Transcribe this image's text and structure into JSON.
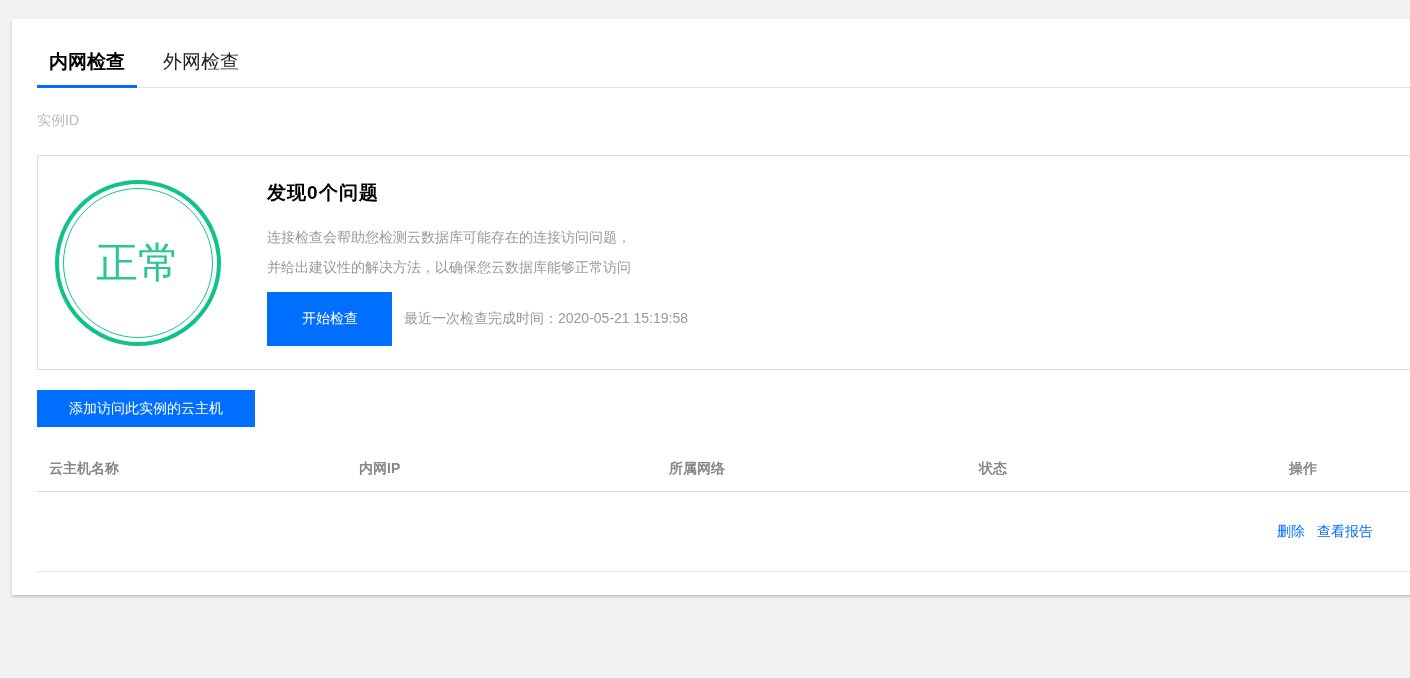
{
  "tabs": [
    {
      "label": "内网检查",
      "selected": true
    },
    {
      "label": "外网检查",
      "selected": false
    }
  ],
  "instance_label": "实例ID",
  "check_panel": {
    "status_badge": "正常",
    "title": "发现0个问题",
    "description_lines": [
      "连接检查会帮助您检测云数据库可能存在的连接访问问题，",
      "并给出建议性的解决方法，以确保您云数据库能够正常访问"
    ],
    "start_button": "开始检查",
    "last_check": "最近一次检查完成时间：2020-05-21 15:19:58"
  },
  "add_button": "添加访问此实例的云主机",
  "table": {
    "columns": [
      "云主机名称",
      "内网IP",
      "所属网络",
      "状态",
      "操作"
    ],
    "rows": [
      {
        "actions": [
          "删除",
          "查看报告"
        ]
      }
    ]
  }
}
